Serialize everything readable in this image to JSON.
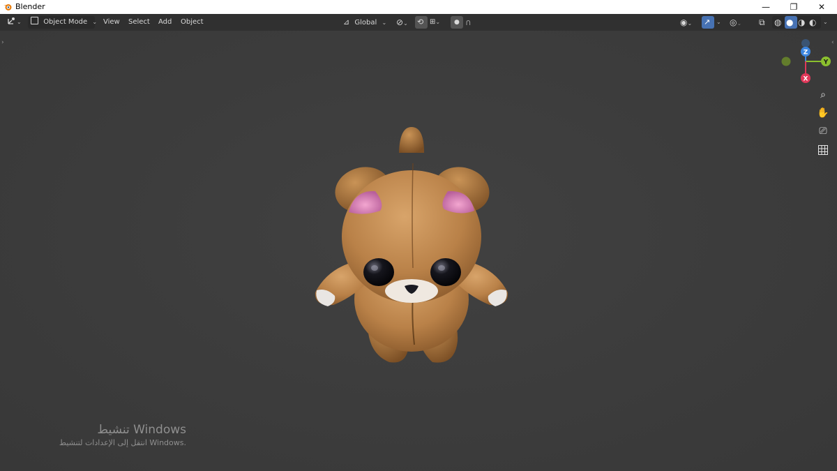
{
  "window": {
    "title": "Blender",
    "controls": [
      "—",
      "❐",
      "✕"
    ]
  },
  "header": {
    "editor_type_icon": "3d-viewport-icon",
    "mode_label": "Object Mode",
    "menus": [
      "View",
      "Select",
      "Add",
      "Object"
    ],
    "transform_orientation": "Global",
    "overlay_icon": "overlays-icon",
    "shading_modes": [
      "wireframe",
      "solid",
      "material-preview",
      "rendered"
    ],
    "active_shading": "solid"
  },
  "gizmo": {
    "z_label": "Z",
    "y_label": "Y",
    "x_label": "X",
    "colors": {
      "x": "#e0385a",
      "y": "#8bc02e",
      "z": "#3d86e0"
    }
  },
  "nav_tools": [
    "zoom-icon",
    "hand-pan-icon",
    "camera-icon",
    "grid-ortho-icon"
  ],
  "activation": {
    "title": "تنشيط Windows",
    "subtitle": "انتقل إلى الإعدادات لتنشيط Windows."
  },
  "colors": {
    "header_bg": "#303030",
    "viewport_bg": "#3d3d3d",
    "accent": "#4772b3",
    "bear_fur": "#c08a4c"
  }
}
